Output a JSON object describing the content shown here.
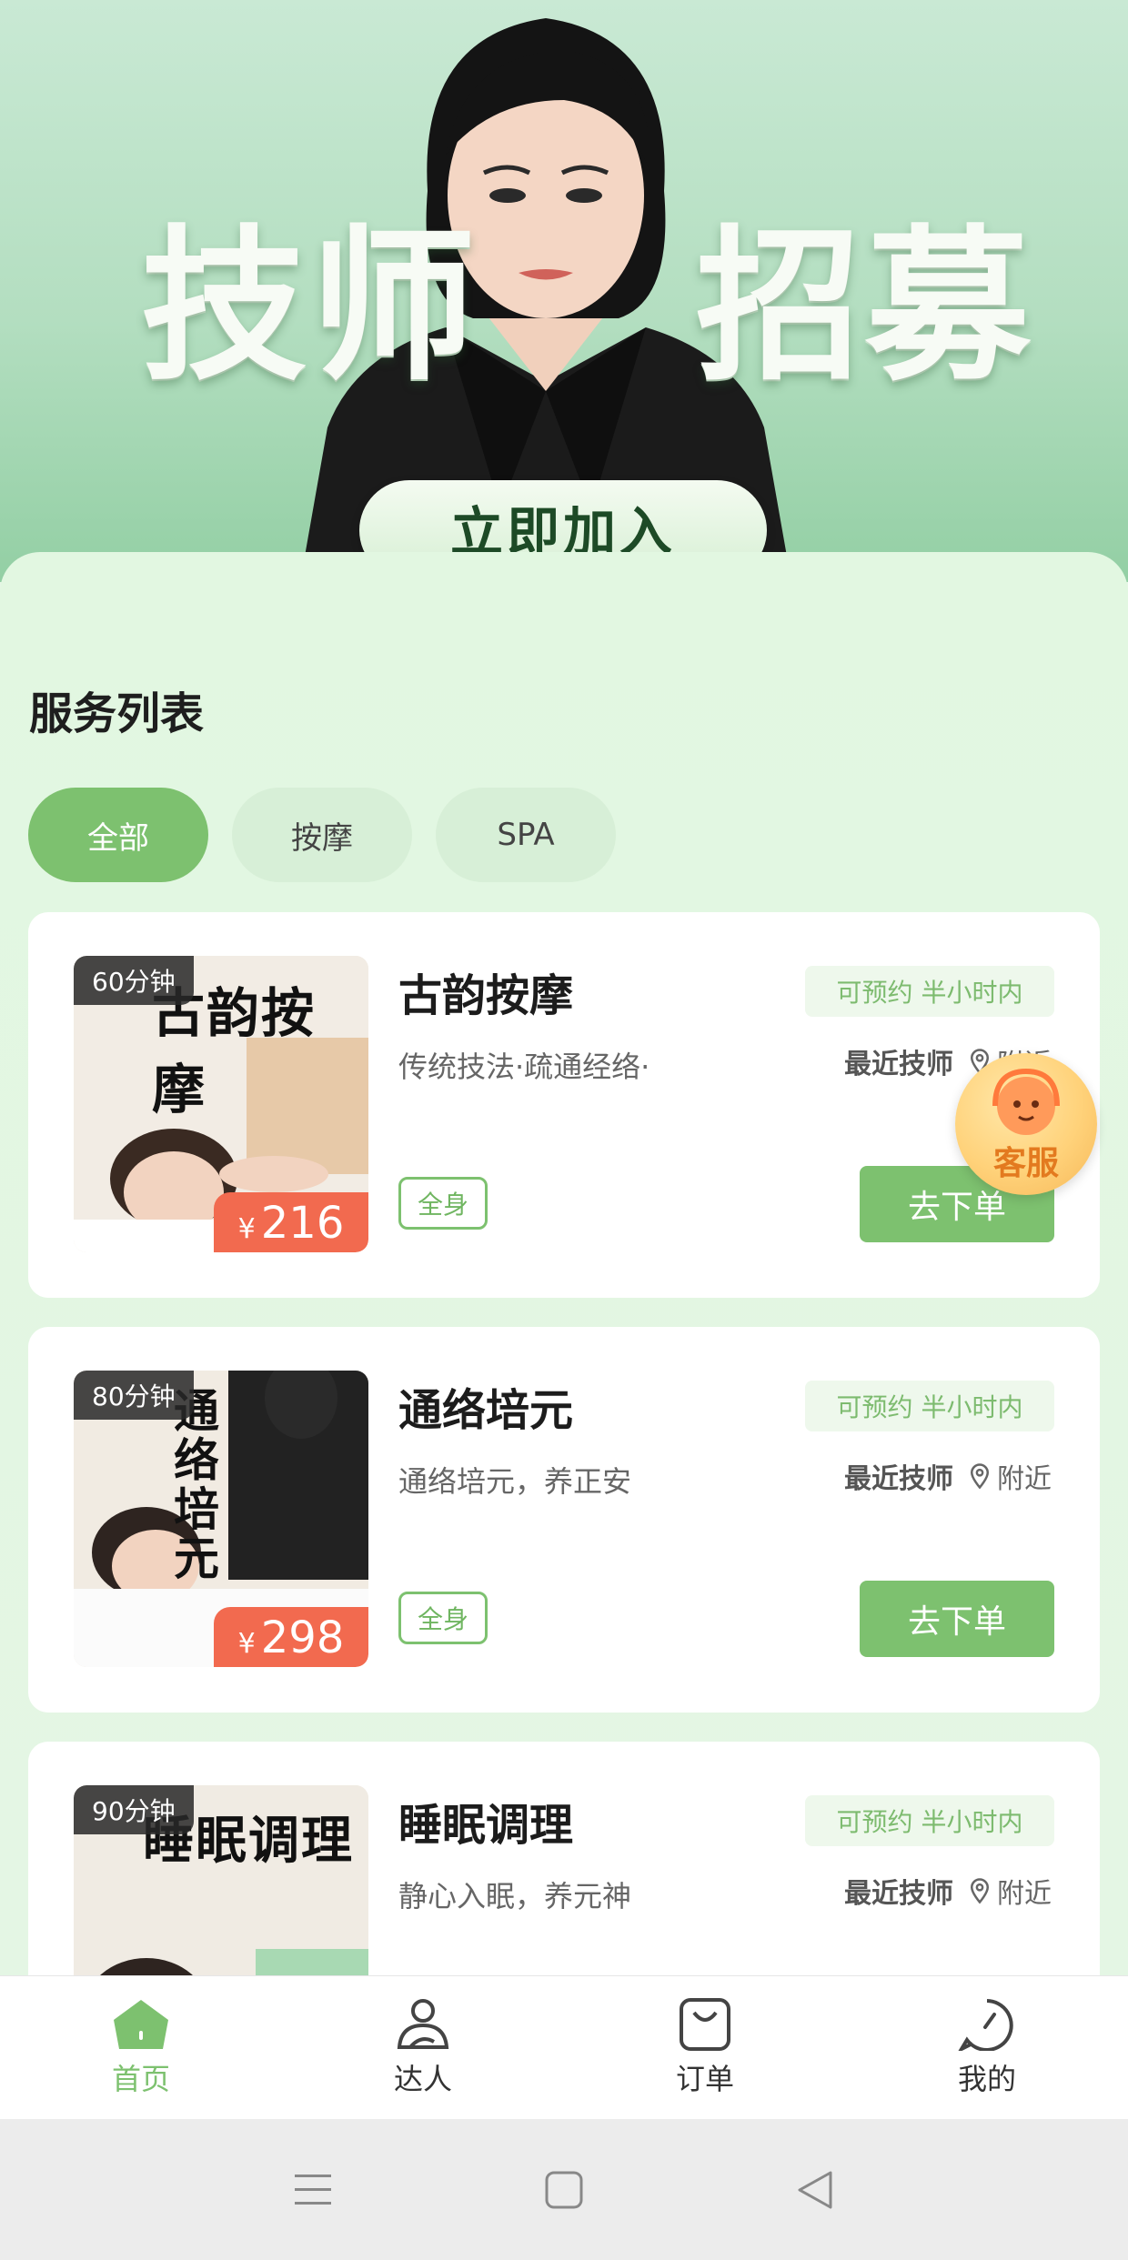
{
  "hero": {
    "title_left": "技师",
    "title_right": "招募",
    "join_label": "立即加入"
  },
  "section": {
    "title": "服务列表"
  },
  "tabs": [
    {
      "label": "全部",
      "active": true
    },
    {
      "label": "按摩",
      "active": false
    },
    {
      "label": "SPA",
      "active": false
    }
  ],
  "services": [
    {
      "duration": "60分钟",
      "thumb_text": "古韵按摩",
      "title": "古韵按摩",
      "desc": "传统技法·疏通经络·",
      "availability": "可预约 半小时内",
      "nearest_label": "最近技师",
      "location": "附近",
      "tag": "全身",
      "price_symbol": "¥",
      "price": "216",
      "order_label": "去下单"
    },
    {
      "duration": "80分钟",
      "thumb_text": "通络培元",
      "title": "通络培元",
      "desc": "通络培元，养正安",
      "availability": "可预约 半小时内",
      "nearest_label": "最近技师",
      "location": "附近",
      "tag": "全身",
      "price_symbol": "¥",
      "price": "298",
      "order_label": "去下单"
    },
    {
      "duration": "90分钟",
      "thumb_text": "睡眠调理",
      "title": "睡眠调理",
      "desc": "静心入眠，养元神",
      "availability": "可预约 半小时内",
      "nearest_label": "最近技师",
      "location": "附近"
    }
  ],
  "customer_service": {
    "label": "客服"
  },
  "nav": [
    {
      "label": "首页",
      "icon": "home-icon",
      "active": true
    },
    {
      "label": "达人",
      "icon": "person-icon",
      "active": false
    },
    {
      "label": "订单",
      "icon": "bag-icon",
      "active": false
    },
    {
      "label": "我的",
      "icon": "profile-icon",
      "active": false
    }
  ],
  "colors": {
    "accent": "#7dc16f",
    "price": "#f26a4f",
    "panel_bg": "#e2f7e1"
  }
}
